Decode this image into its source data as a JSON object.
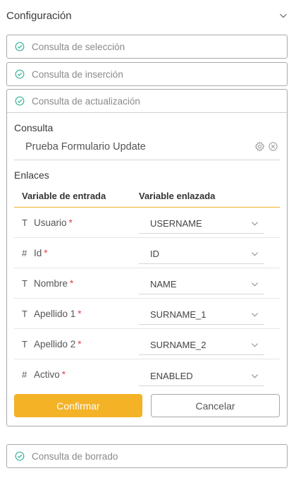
{
  "header": {
    "title": "Configuración",
    "chevron_icon": "chevron-down-icon"
  },
  "queries": {
    "select": {
      "label": "Consulta de selección"
    },
    "insert": {
      "label": "Consulta de inserción"
    },
    "update": {
      "label": "Consulta de actualización"
    },
    "delete": {
      "label": "Consulta de borrado"
    },
    "status_icon": "check-circle-icon",
    "status_color": "#3bb39a"
  },
  "update_panel": {
    "consulta_label": "Consulta",
    "consulta_value": "Prueba Formulario Update",
    "consulta_icons": [
      "gear-icon",
      "clear-icon"
    ],
    "enlaces_label": "Enlaces",
    "columns": {
      "input_variable": "Variable de entrada",
      "linked_variable": "Variable enlazada"
    },
    "rows": [
      {
        "type_symbol": "T",
        "type": "text",
        "name": "Usuario",
        "required": "*",
        "value": "USERNAME"
      },
      {
        "type_symbol": "#",
        "type": "number",
        "name": "Id",
        "required": "*",
        "value": "ID"
      },
      {
        "type_symbol": "T",
        "type": "text",
        "name": "Nombre",
        "required": "*",
        "value": "NAME"
      },
      {
        "type_symbol": "T",
        "type": "text",
        "name": "Apellido 1",
        "required": "*",
        "value": "SURNAME_1"
      },
      {
        "type_symbol": "T",
        "type": "text",
        "name": "Apellido 2",
        "required": "*",
        "value": "SURNAME_2"
      },
      {
        "type_symbol": "#",
        "type": "number",
        "name": "Activo",
        "required": "*",
        "value": "ENABLED"
      }
    ],
    "confirm_label": "Confirmar",
    "cancel_label": "Cancelar"
  },
  "colors": {
    "accent": "#f4b226",
    "required": "#e0404a",
    "check": "#3bb39a"
  }
}
